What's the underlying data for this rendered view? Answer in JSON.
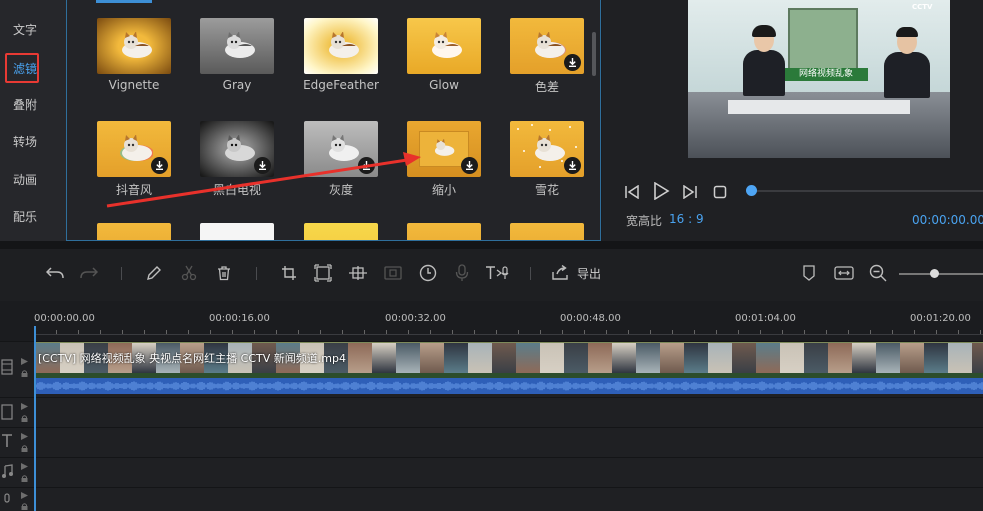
{
  "sidebar": {
    "items": [
      {
        "label": "文字"
      },
      {
        "label": "滤镜"
      },
      {
        "label": "叠附"
      },
      {
        "label": "转场"
      },
      {
        "label": "动画"
      },
      {
        "label": "配乐"
      }
    ],
    "active_index": 1
  },
  "filters": [
    {
      "name": "Vignette",
      "downloadable": false
    },
    {
      "name": "Gray",
      "downloadable": false
    },
    {
      "name": "EdgeFeather",
      "downloadable": false
    },
    {
      "name": "Glow",
      "downloadable": false
    },
    {
      "name": "色差",
      "downloadable": true
    },
    {
      "name": "抖音风",
      "downloadable": true
    },
    {
      "name": "黑白电视",
      "downloadable": true
    },
    {
      "name": "灰度",
      "downloadable": true
    },
    {
      "name": "缩小",
      "downloadable": true
    },
    {
      "name": "雪花",
      "downloadable": true
    }
  ],
  "preview": {
    "aspect_label": "宽高比",
    "aspect_value": "16 : 9",
    "timecode": "00:00:00.00",
    "banner_text": "网络视频乱象",
    "channel_logo": "CCTV"
  },
  "toolbar": {
    "export_label": "导出"
  },
  "timeline": {
    "ruler_labels": [
      "00:00:00.00",
      "00:00:16.00",
      "00:00:32.00",
      "00:00:48.00",
      "00:01:04.00",
      "00:01:20.00"
    ],
    "clip_title": "[CCTV] 网络视频乱象 央视点名网红主播 CCTV 新闻频道.mp4"
  },
  "colors": {
    "accent": "#4aa3f0",
    "highlight": "#e83a34",
    "audio": "#2e5fb8"
  }
}
